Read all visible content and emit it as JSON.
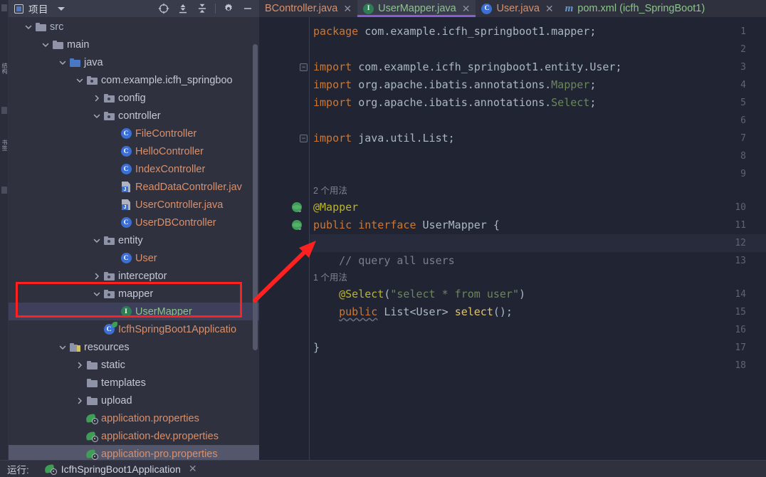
{
  "panel": {
    "title": "项目",
    "icon": "project-panel-icon",
    "tools": [
      {
        "name": "locate-icon",
        "label": "Select Opened File"
      },
      {
        "name": "expand-all-icon",
        "label": "Expand All"
      },
      {
        "name": "collapse-all-icon",
        "label": "Collapse All"
      },
      {
        "name": "gear-icon",
        "label": "Settings"
      },
      {
        "name": "minimize-icon",
        "label": "Hide"
      }
    ]
  },
  "toolstrip": {
    "tabs": [
      "结构",
      "书签"
    ]
  },
  "tree": [
    {
      "label": "src",
      "indent": 0,
      "arrow": "down",
      "icon": "folder",
      "color": "src",
      "state": "normal"
    },
    {
      "label": "main",
      "indent": 1,
      "arrow": "down",
      "icon": "folder",
      "color": "folder",
      "state": "normal"
    },
    {
      "label": "java",
      "indent": 2,
      "arrow": "down",
      "icon": "folder-blue",
      "color": "folder",
      "state": "normal"
    },
    {
      "label": "com.example.icfh_springboo",
      "indent": 3,
      "arrow": "down",
      "icon": "folder-pkg",
      "color": "folder",
      "state": "normal"
    },
    {
      "label": "config",
      "indent": 4,
      "arrow": "right",
      "icon": "folder-pkg",
      "color": "folder",
      "state": "normal"
    },
    {
      "label": "controller",
      "indent": 4,
      "arrow": "down",
      "icon": "folder-pkg",
      "color": "folder",
      "state": "normal"
    },
    {
      "label": "FileController",
      "indent": 5,
      "arrow": "none",
      "icon": "class-badge",
      "color": "file",
      "state": "normal"
    },
    {
      "label": "HelloController",
      "indent": 5,
      "arrow": "none",
      "icon": "class-badge",
      "color": "file",
      "state": "normal"
    },
    {
      "label": "IndexController",
      "indent": 5,
      "arrow": "none",
      "icon": "class-badge",
      "color": "file",
      "state": "normal"
    },
    {
      "label": "ReadDataController.jav",
      "indent": 5,
      "arrow": "none",
      "icon": "java-file",
      "color": "file",
      "state": "normal"
    },
    {
      "label": "UserController.java",
      "indent": 5,
      "arrow": "none",
      "icon": "java-file",
      "color": "file",
      "state": "normal"
    },
    {
      "label": "UserDBController",
      "indent": 5,
      "arrow": "none",
      "icon": "class-badge",
      "color": "file",
      "state": "normal"
    },
    {
      "label": "entity",
      "indent": 4,
      "arrow": "down",
      "icon": "folder-pkg",
      "color": "folder",
      "state": "normal"
    },
    {
      "label": "User",
      "indent": 5,
      "arrow": "none",
      "icon": "class-badge",
      "color": "file",
      "state": "normal"
    },
    {
      "label": "interceptor",
      "indent": 4,
      "arrow": "right",
      "icon": "folder-pkg",
      "color": "folder",
      "state": "normal"
    },
    {
      "label": "mapper",
      "indent": 4,
      "arrow": "down",
      "icon": "folder-pkg",
      "color": "folder",
      "state": "normal"
    },
    {
      "label": "UserMapper",
      "indent": 5,
      "arrow": "none",
      "icon": "interface-badge",
      "color": "iface",
      "state": "selected"
    },
    {
      "label": "IcfhSpringBoot1Applicatio",
      "indent": 4,
      "arrow": "none",
      "icon": "spring-app",
      "color": "file",
      "state": "normal"
    },
    {
      "label": "resources",
      "indent": 2,
      "arrow": "down",
      "icon": "folder-res",
      "color": "folder",
      "state": "normal"
    },
    {
      "label": "static",
      "indent": 3,
      "arrow": "right",
      "icon": "folder",
      "color": "folder",
      "state": "normal"
    },
    {
      "label": "templates",
      "indent": 3,
      "arrow": "none",
      "icon": "folder",
      "color": "folder",
      "state": "normal"
    },
    {
      "label": "upload",
      "indent": 3,
      "arrow": "right",
      "icon": "folder",
      "color": "folder",
      "state": "normal"
    },
    {
      "label": "application.properties",
      "indent": 3,
      "arrow": "none",
      "icon": "spring-prop",
      "color": "file",
      "state": "normal"
    },
    {
      "label": "application-dev.properties",
      "indent": 3,
      "arrow": "none",
      "icon": "spring-prop",
      "color": "file",
      "state": "normal"
    },
    {
      "label": "application-pro.properties",
      "indent": 3,
      "arrow": "none",
      "icon": "spring-prop",
      "color": "file",
      "state": "faint-sel"
    }
  ],
  "editor_tabs": [
    {
      "label": "BController.java",
      "icon": "none",
      "color": "orange",
      "active": false,
      "closable": true
    },
    {
      "label": "UserMapper.java",
      "icon": "interface",
      "color": "green",
      "active": true,
      "closable": true
    },
    {
      "label": "User.java",
      "icon": "class",
      "color": "orange",
      "active": false,
      "closable": true
    },
    {
      "label": "pom.xml (icfh_SpringBoot1)",
      "icon": "maven",
      "color": "green",
      "active": false,
      "closable": false
    }
  ],
  "code": {
    "first_line": 1,
    "last_line": 18,
    "gutter_icons": [
      {
        "line": 10,
        "name": "mybatis-mapper-statement-icon"
      },
      {
        "line": 11,
        "name": "mybatis-mapper-icon"
      }
    ],
    "fold_markers": [
      {
        "line": 3,
        "glyph": "−"
      },
      {
        "line": 7,
        "glyph": "−"
      }
    ],
    "caret_line": 12,
    "inlay_hints": [
      {
        "above_line": 10,
        "text": "2 个用法"
      },
      {
        "above_line": 14,
        "text": "1 个用法"
      }
    ],
    "lines": [
      {
        "n": 1,
        "tokens": [
          {
            "t": "package ",
            "c": "kw"
          },
          {
            "t": "com.example.icfh_springboot1.mapper;",
            "c": "txt"
          }
        ]
      },
      {
        "n": 2,
        "tokens": []
      },
      {
        "n": 3,
        "tokens": [
          {
            "t": "import ",
            "c": "kw"
          },
          {
            "t": "com.example.icfh_springboot1.entity.User;",
            "c": "txt"
          }
        ]
      },
      {
        "n": 4,
        "tokens": [
          {
            "t": "import ",
            "c": "kw"
          },
          {
            "t": "org.apache.ibatis.annotations.",
            "c": "txt"
          },
          {
            "t": "Mapper",
            "c": "grn"
          },
          {
            "t": ";",
            "c": "txt"
          }
        ]
      },
      {
        "n": 5,
        "tokens": [
          {
            "t": "import ",
            "c": "kw"
          },
          {
            "t": "org.apache.ibatis.annotations.",
            "c": "txt"
          },
          {
            "t": "Select",
            "c": "grn"
          },
          {
            "t": ";",
            "c": "txt"
          }
        ]
      },
      {
        "n": 6,
        "tokens": []
      },
      {
        "n": 7,
        "tokens": [
          {
            "t": "import ",
            "c": "kw"
          },
          {
            "t": "java.util.List;",
            "c": "txt"
          }
        ]
      },
      {
        "n": 8,
        "tokens": []
      },
      {
        "n": 9,
        "tokens": []
      },
      {
        "n": 10,
        "tokens": [
          {
            "t": "@Mapper",
            "c": "ann"
          }
        ]
      },
      {
        "n": 11,
        "tokens": [
          {
            "t": "public ",
            "c": "kw"
          },
          {
            "t": "interface ",
            "c": "kw"
          },
          {
            "t": "UserMapper ",
            "c": "cls"
          },
          {
            "t": "{",
            "c": "txt"
          }
        ]
      },
      {
        "n": 12,
        "tokens": []
      },
      {
        "n": 13,
        "tokens": [
          {
            "t": "    // query all users",
            "c": "cmt"
          }
        ]
      },
      {
        "n": 14,
        "tokens": [
          {
            "t": "    ",
            "c": "txt"
          },
          {
            "t": "@Select",
            "c": "ann"
          },
          {
            "t": "(",
            "c": "txt"
          },
          {
            "t": "\"select * from user\"",
            "c": "grn"
          },
          {
            "t": ")",
            "c": "txt"
          }
        ]
      },
      {
        "n": 15,
        "tokens": [
          {
            "t": "    ",
            "c": "txt"
          },
          {
            "t": "public",
            "c": "kw",
            "wavy": true
          },
          {
            "t": " ",
            "c": "txt"
          },
          {
            "t": "List",
            "c": "cls"
          },
          {
            "t": "<",
            "c": "txt"
          },
          {
            "t": "User",
            "c": "cls"
          },
          {
            "t": "> ",
            "c": "txt"
          },
          {
            "t": "select",
            "c": "yel"
          },
          {
            "t": "();",
            "c": "txt"
          }
        ]
      },
      {
        "n": 16,
        "tokens": []
      },
      {
        "n": 17,
        "tokens": [
          {
            "t": "}",
            "c": "txt"
          }
        ]
      },
      {
        "n": 18,
        "tokens": []
      }
    ]
  },
  "bottom_bar": {
    "run_label": "运行:",
    "config_name": "IcfhSpringBoot1Application",
    "close_glyph": "✕"
  },
  "annotations": {
    "highlight_rect": {
      "name": "red-highlight-rectangle",
      "color": "#FF2020"
    },
    "arrow": {
      "name": "red-pointer-arrow",
      "color": "#FF2020"
    }
  },
  "colors": {
    "accent_tab_underline": "#8B5CD6",
    "selection": "#3E3F5B",
    "editor_bg": "#212433",
    "panel_bg": "#2F313E",
    "annotation_red": "#FF2020"
  }
}
